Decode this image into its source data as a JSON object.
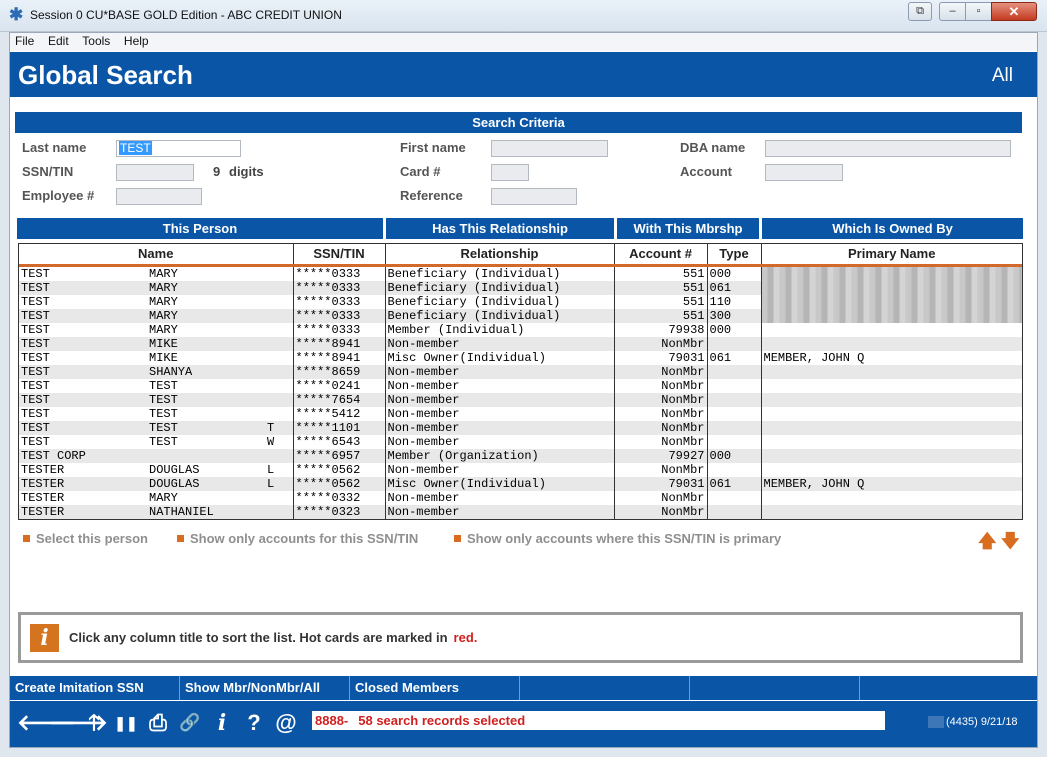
{
  "window": {
    "title": "Session 0 CU*BASE GOLD Edition - ABC CREDIT UNION",
    "buttons": {
      "extra": "⧉",
      "minimize": "–",
      "maximize": "▫",
      "close": "✕"
    }
  },
  "menu": [
    "File",
    "Edit",
    "Tools",
    "Help"
  ],
  "header": {
    "title": "Global Search",
    "scope": "All"
  },
  "criteria": {
    "heading": "Search Criteria",
    "last_name_label": "Last name",
    "last_name_value": "TEST",
    "first_name_label": "First name",
    "first_name_value": "",
    "dba_label": "DBA name",
    "dba_value": "",
    "ssn_label": "SSN/TIN",
    "ssn_value": "",
    "digits_count": "9",
    "digits_label": "digits",
    "card_label": "Card #",
    "card_value": "",
    "account_label": "Account",
    "account_value": "",
    "employee_label": "Employee #",
    "employee_value": "",
    "reference_label": "Reference",
    "reference_value": ""
  },
  "groups": [
    "This Person",
    "Has This Relationship",
    "With This Mbrshp",
    "Which Is Owned By"
  ],
  "columns": [
    "Name",
    "SSN/TIN",
    "Relationship",
    "Account #",
    "Type",
    "Primary Name"
  ],
  "rows": [
    {
      "last": "TEST",
      "first": "MARY",
      "mi": "",
      "ssn": "*****0333",
      "rel": "Beneficiary (Individual)",
      "acct": "551",
      "type": "000",
      "primary": "",
      "blur": true
    },
    {
      "last": "TEST",
      "first": "MARY",
      "mi": "",
      "ssn": "*****0333",
      "rel": "Beneficiary (Individual)",
      "acct": "551",
      "type": "061",
      "primary": "",
      "blur": true
    },
    {
      "last": "TEST",
      "first": "MARY",
      "mi": "",
      "ssn": "*****0333",
      "rel": "Beneficiary (Individual)",
      "acct": "551",
      "type": "110",
      "primary": "",
      "blur": true
    },
    {
      "last": "TEST",
      "first": "MARY",
      "mi": "",
      "ssn": "*****0333",
      "rel": "Beneficiary (Individual)",
      "acct": "551",
      "type": "300",
      "primary": "",
      "blur": true
    },
    {
      "last": "TEST",
      "first": "MARY",
      "mi": "",
      "ssn": "*****0333",
      "rel": "Member (Individual)",
      "acct": "79938",
      "type": "000",
      "primary": "",
      "blur": false
    },
    {
      "last": "TEST",
      "first": "MIKE",
      "mi": "",
      "ssn": "*****8941",
      "rel": "Non-member",
      "acct": "NonMbr",
      "type": "",
      "primary": "",
      "blur": false
    },
    {
      "last": "TEST",
      "first": "MIKE",
      "mi": "",
      "ssn": "*****8941",
      "rel": "Misc Owner(Individual)",
      "acct": "79031",
      "type": "061",
      "primary": "MEMBER, JOHN Q",
      "blur": false
    },
    {
      "last": "TEST",
      "first": "SHANYA",
      "mi": "",
      "ssn": "*****8659",
      "rel": "Non-member",
      "acct": "NonMbr",
      "type": "",
      "primary": "",
      "blur": false
    },
    {
      "last": "TEST",
      "first": "TEST",
      "mi": "",
      "ssn": "*****0241",
      "rel": "Non-member",
      "acct": "NonMbr",
      "type": "",
      "primary": "",
      "blur": false
    },
    {
      "last": "TEST",
      "first": "TEST",
      "mi": "",
      "ssn": "*****7654",
      "rel": "Non-member",
      "acct": "NonMbr",
      "type": "",
      "primary": "",
      "blur": false
    },
    {
      "last": "TEST",
      "first": "TEST",
      "mi": "",
      "ssn": "*****5412",
      "rel": "Non-member",
      "acct": "NonMbr",
      "type": "",
      "primary": "",
      "blur": false
    },
    {
      "last": "TEST",
      "first": "TEST",
      "mi": "T",
      "ssn": "*****1101",
      "rel": "Non-member",
      "acct": "NonMbr",
      "type": "",
      "primary": "",
      "blur": false
    },
    {
      "last": "TEST",
      "first": "TEST",
      "mi": "W",
      "ssn": "*****6543",
      "rel": "Non-member",
      "acct": "NonMbr",
      "type": "",
      "primary": "",
      "blur": false
    },
    {
      "last": "TEST CORP",
      "first": "",
      "mi": "",
      "ssn": "*****6957",
      "rel": "Member (Organization)",
      "acct": "79927",
      "type": "000",
      "primary": "",
      "blur": false
    },
    {
      "last": "TESTER",
      "first": "DOUGLAS",
      "mi": "L",
      "ssn": "*****0562",
      "rel": "Non-member",
      "acct": "NonMbr",
      "type": "",
      "primary": "",
      "blur": false
    },
    {
      "last": "TESTER",
      "first": "DOUGLAS",
      "mi": "L",
      "ssn": "*****0562",
      "rel": "Misc Owner(Individual)",
      "acct": "79031",
      "type": "061",
      "primary": "MEMBER, JOHN Q",
      "blur": false
    },
    {
      "last": "TESTER",
      "first": "MARY",
      "mi": "",
      "ssn": "*****0332",
      "rel": "Non-member",
      "acct": "NonMbr",
      "type": "",
      "primary": "",
      "blur": false
    },
    {
      "last": "TESTER",
      "first": "NATHANIEL",
      "mi": "",
      "ssn": "*****0323",
      "rel": "Non-member",
      "acct": "NonMbr",
      "type": "",
      "primary": "",
      "blur": false
    }
  ],
  "options": {
    "select": "Select this person",
    "only_accounts": "Show only accounts for this SSN/TIN",
    "only_primary": "Show only accounts where this SSN/TIN is primary",
    "up": "🡅",
    "down": "🡇"
  },
  "info": {
    "icon": "i",
    "message": "Click any column title to sort the list. Hot cards are marked in",
    "highlight": "red."
  },
  "function_keys": [
    "Create Imitation SSN",
    "Show Mbr/NonMbr/All",
    "Closed Members",
    "",
    "",
    "",
    ""
  ],
  "toolbar": {
    "back": "🡐",
    "forward": "🡒",
    "up": "🡑",
    "pause": "❚❚",
    "print": "⎙",
    "link": "🔗",
    "info": "i",
    "help": "?",
    "at": "@"
  },
  "status": {
    "code": "8888-",
    "message": "58 search records selected"
  },
  "system": "(4435) 9/21/18",
  "colors": {
    "accent": "#0a55a6",
    "highlight": "#d86c20",
    "alert": "#d11f1f"
  }
}
